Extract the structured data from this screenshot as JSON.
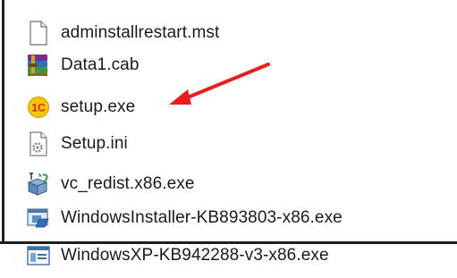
{
  "files": [
    {
      "name": "adminstallrestart.mst",
      "icon": "blank-file-icon"
    },
    {
      "name": "Data1.cab",
      "icon": "winrar-archive-icon"
    },
    {
      "name": "setup.exe",
      "icon": "1c-setup-icon"
    },
    {
      "name": "Setup.ini",
      "icon": "settings-file-icon"
    },
    {
      "name": "vc_redist.x86.exe",
      "icon": "installer-package-icon"
    },
    {
      "name": "WindowsInstaller-KB893803-x86.exe",
      "icon": "windows-installer-icon"
    },
    {
      "name": "WindowsXP-KB942288-v3-x86.exe",
      "icon": "application-window-icon"
    }
  ],
  "annotation": {
    "type": "arrow",
    "color": "#e81e1e",
    "points_to": "setup.exe"
  }
}
